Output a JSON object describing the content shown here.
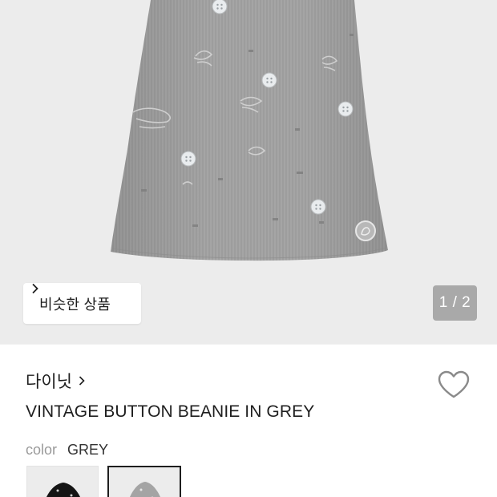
{
  "gallery": {
    "similar_button_label": "비슷한 상품",
    "page_counter": "1 / 2"
  },
  "product": {
    "brand": "다이닛",
    "title": "VINTAGE BUTTON BEANIE IN GREY",
    "color_label": "color",
    "color_value": "GREY",
    "swatches": [
      {
        "name": "black",
        "selected": false
      },
      {
        "name": "grey",
        "selected": true
      }
    ]
  },
  "colors": {
    "hero_background": "#ececec",
    "beanie_grey": "#9e9e9e",
    "text_primary": "#1e1e1e",
    "text_muted": "#9a9a9a",
    "counter_background": "#a9a9a9"
  },
  "icons": [
    "chevron-right-icon",
    "heart-outline-icon"
  ]
}
